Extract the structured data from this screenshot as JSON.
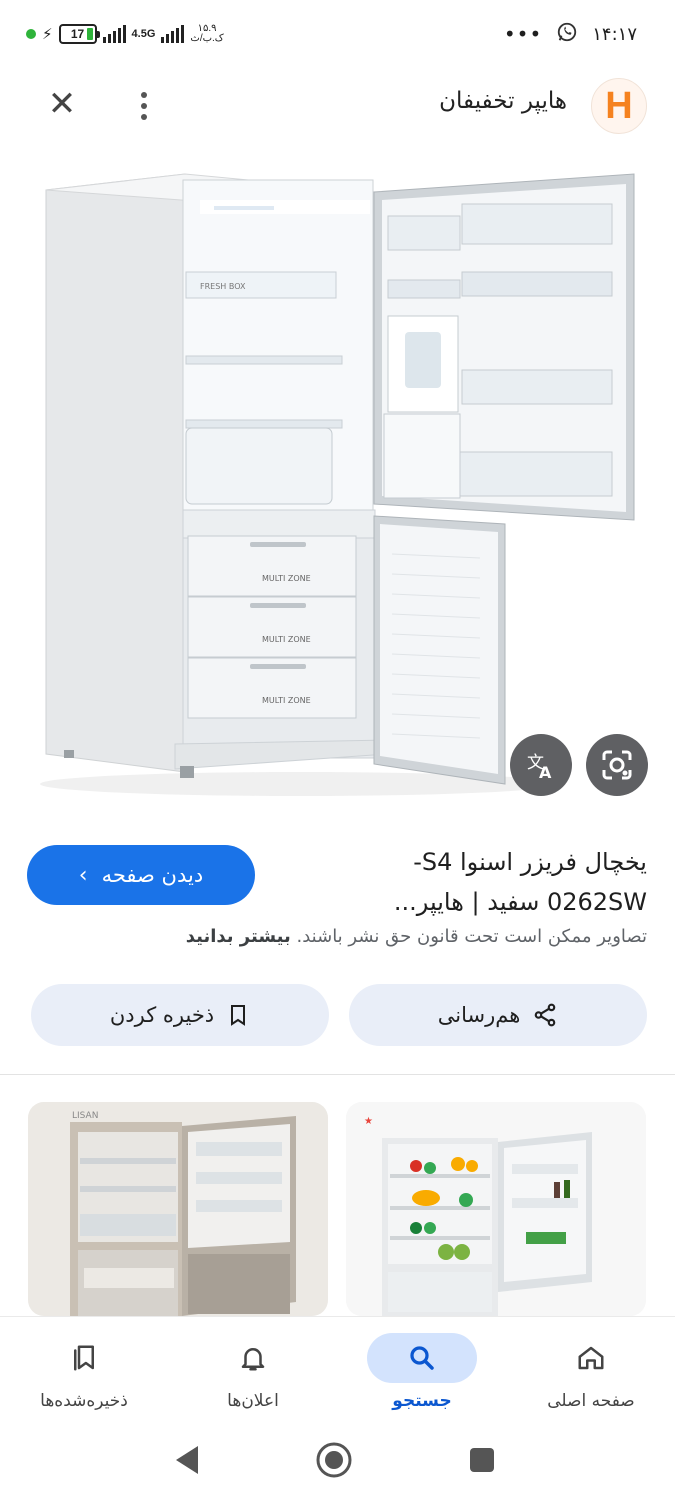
{
  "status_bar": {
    "time": "۱۴:۱۷",
    "more_icons": "•••",
    "battery_level": "17",
    "network_type": "4.5G",
    "speed_value": "۱۵.۹",
    "speed_unit": "ک.ب/ث"
  },
  "top_bar": {
    "site_name": "هایپر تخفیفان",
    "logo_letter": "H",
    "logo_color": "#f5821f"
  },
  "main_image": {
    "drawer_labels": [
      "MULTI ZONE",
      "MULTI ZONE",
      "MULTI ZONE"
    ],
    "fresh_box_label": "FRESH BOX",
    "lens_button_icon": "lens-icon",
    "translate_button_icon": "translate-icon"
  },
  "result": {
    "title_line1": "یخچال فریزر اسنوا S4-",
    "title_line2": "0262SW سفید | هایپر...",
    "visit_label": "دیدن صفحه",
    "copyright_text": "تصاویر ممکن است تحت قانون حق نشر باشند.",
    "learn_more": "بیشتر بدانید",
    "share_label": "هم‌رسانی",
    "save_label": "ذخیره کردن"
  },
  "bottom_nav": {
    "items": [
      {
        "label": "صفحه اصلی",
        "icon": "home-icon"
      },
      {
        "label": "جستجو",
        "icon": "search-icon",
        "active": true
      },
      {
        "label": "اعلان‌ها",
        "icon": "bell-icon"
      },
      {
        "label": "ذخیره‌شده‌ها",
        "icon": "bookmarks-icon"
      }
    ]
  },
  "colors": {
    "accent": "#1a73e8",
    "pill_bg": "#e9eef8",
    "nav_active_bg": "#d3e3fd"
  }
}
